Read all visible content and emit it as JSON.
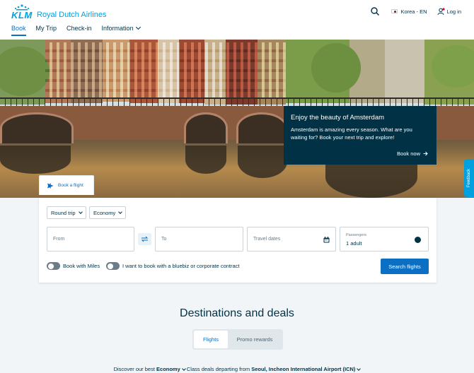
{
  "header": {
    "logo_short": "KLM",
    "logo_name": "Royal Dutch Airlines",
    "nav": [
      {
        "label": "Book"
      },
      {
        "label": "My Trip"
      },
      {
        "label": "Check-in"
      },
      {
        "label": "Information"
      }
    ],
    "locale": "Korea - EN",
    "login": "Log in"
  },
  "hero": {
    "promo_title": "Enjoy the beauty of Amsterdam",
    "promo_text": "Amsterdam is amazing every season. What are you waiting for? Book your next trip and explore!",
    "promo_cta": "Book now",
    "feedback": "Feedback",
    "booking_tab": "Book a flight"
  },
  "booking": {
    "trip_type": "Round trip",
    "cabin_class": "Economy",
    "from_placeholder": "From",
    "to_placeholder": "To",
    "dates_placeholder": "Travel dates",
    "passengers_label": "Passengers",
    "passengers_value": "1 adult",
    "miles_toggle": "Book with Miles",
    "bluebiz_toggle": "I want to book with a bluebiz or corporate contract",
    "search_button": "Search flights"
  },
  "destinations": {
    "title": "Destinations and deals",
    "tabs": [
      "Flights",
      "Promo rewards"
    ],
    "deals_prefix": "Discover our best",
    "deals_class": "Economy",
    "deals_middle": "Class deals departing from",
    "deals_airport": "Seoul, Incheon International Airport (ICN)"
  },
  "colors": {
    "brand": "#00a1de",
    "primary_button": "#0b6fc4",
    "navy": "#003145"
  }
}
